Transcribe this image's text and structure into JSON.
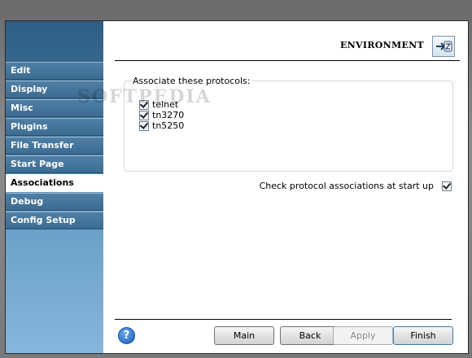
{
  "header": {
    "title": "ENVIRONMENT",
    "icon": "environment-settings-icon"
  },
  "sidebar": {
    "items": [
      {
        "label": "Edit",
        "active": false
      },
      {
        "label": "Display",
        "active": false
      },
      {
        "label": "Misc",
        "active": false
      },
      {
        "label": "Plugins",
        "active": false
      },
      {
        "label": "File Transfer",
        "active": false
      },
      {
        "label": "Start Page",
        "active": false
      },
      {
        "label": "Associations",
        "active": true
      },
      {
        "label": "Debug",
        "active": false
      },
      {
        "label": "Config Setup",
        "active": false
      }
    ]
  },
  "protocols": {
    "legend": "Associate these protocols:",
    "items": [
      {
        "label": "telnet",
        "checked": true
      },
      {
        "label": "tn3270",
        "checked": true
      },
      {
        "label": "tn5250",
        "checked": true
      }
    ]
  },
  "startup_check": {
    "label": "Check protocol associations at start up",
    "checked": true
  },
  "footer": {
    "help_glyph": "?",
    "main_label": "Main",
    "back_label": "Back",
    "apply_label": "Apply",
    "finish_label": "Finish"
  },
  "watermark": "SOFTPEDIA"
}
